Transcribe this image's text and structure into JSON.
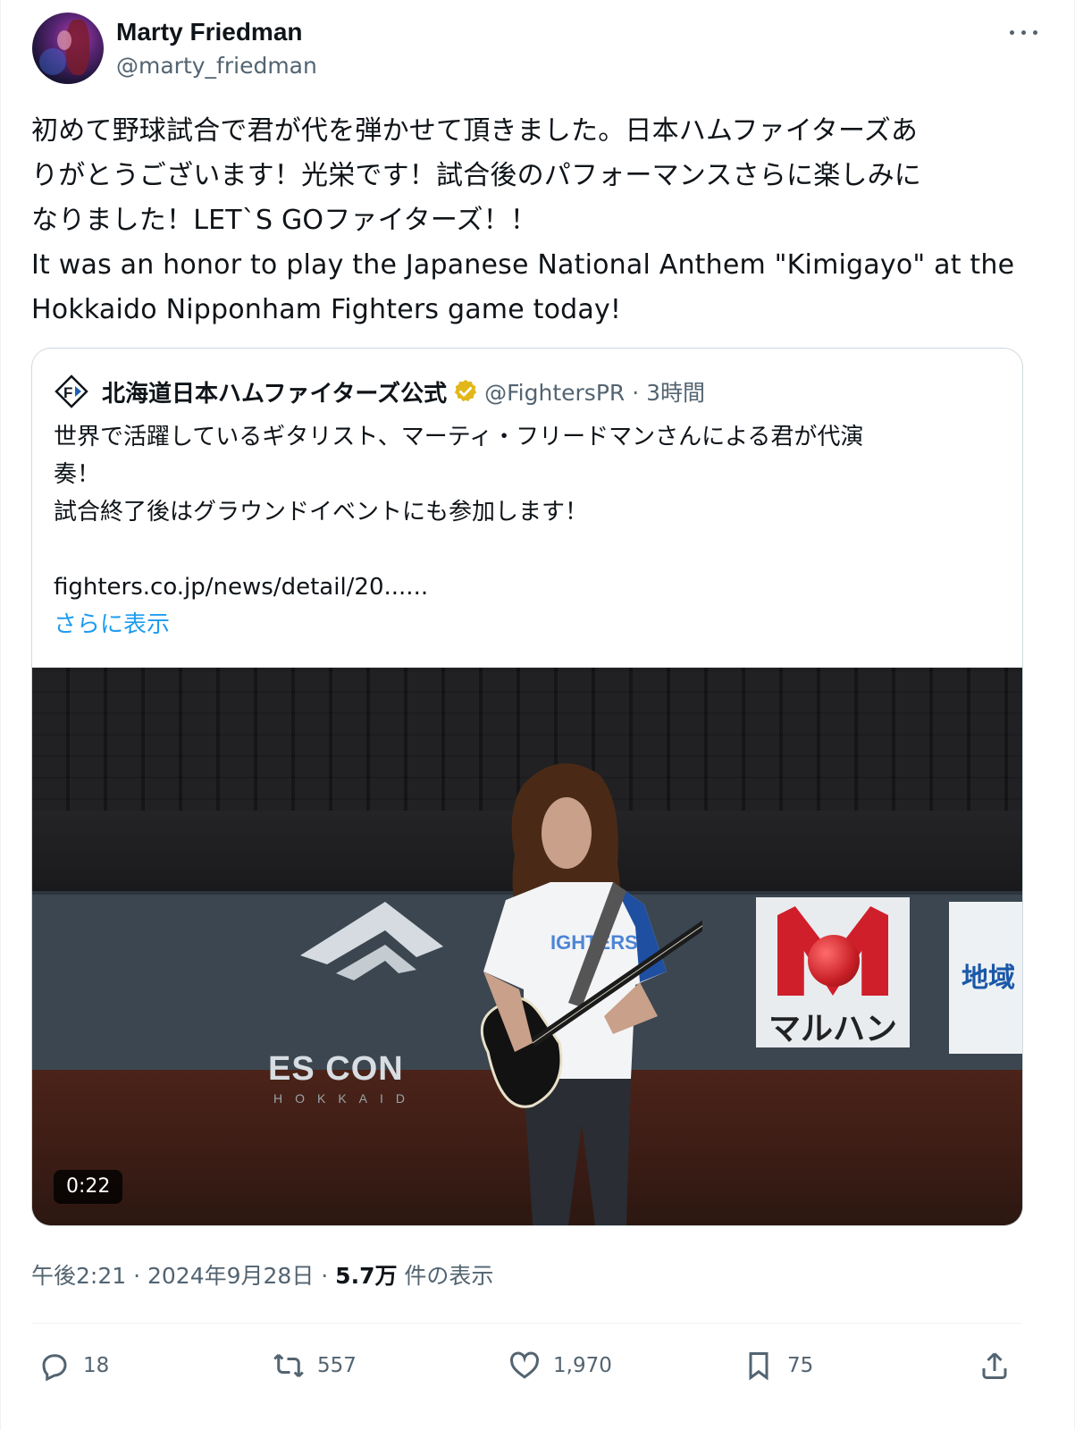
{
  "author": {
    "display_name": "Marty Friedman",
    "handle": "@marty_friedman"
  },
  "tweet": {
    "text": "初めて野球試合で君が代を弾かせて頂きました。日本ハムファイターズあ\nりがとうございます！光栄です！試合後のパフォーマンスさらに楽しみに\nなりました！LET`S GOファイターズ！！\nIt was an honor to play the Japanese National Anthem \"Kimigayo\" at the\nHokkaido Nipponham Fighters game today!"
  },
  "quote": {
    "display_name": "北海道日本ハムファイターズ公式",
    "handle_time": "@FightersPR · 3時間",
    "text": "世界で活躍しているギタリスト、マーティ・フリードマンさんによる君が代演\n奏！\n試合終了後はグラウンドイベントにも参加します！\n\nfighters.co.jp/news/detail/20......",
    "show_more": "さらに表示",
    "video": {
      "duration": "0:22",
      "signage": {
        "stadium": "ES CON",
        "stadium_sub": "HOKKAID",
        "sponsor": "マルハン",
        "sponsor_right": "地域"
      }
    }
  },
  "meta": {
    "time_date": "午後2:21 · 2024年9月28日 · ",
    "views": "5.7万",
    "views_label": " 件の表示"
  },
  "actions": {
    "replies": "18",
    "reposts": "557",
    "likes": "1,970",
    "bookmarks": "75"
  },
  "colors": {
    "text": "#0f1419",
    "secondary": "#536471",
    "link": "#1d9bf0",
    "border": "#cfd9de",
    "verified_gold": "#e2b719"
  },
  "icons": [
    "more-icon",
    "verified-badge-icon",
    "reply-icon",
    "repost-icon",
    "like-icon",
    "bookmark-icon",
    "share-icon"
  ]
}
